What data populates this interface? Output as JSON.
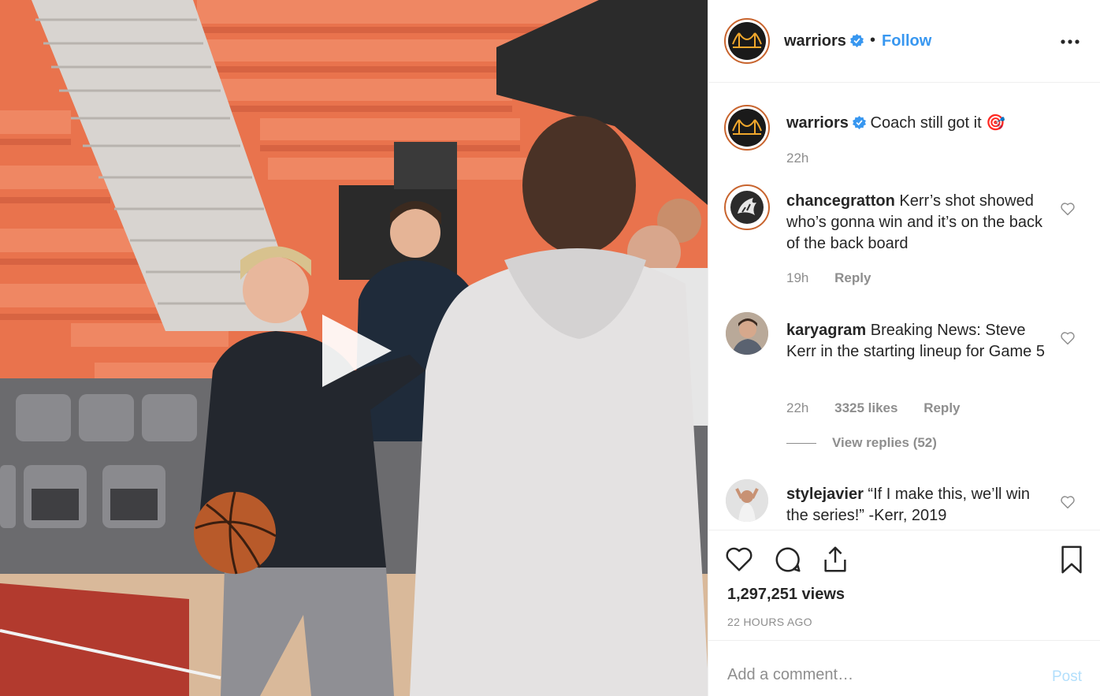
{
  "post": {
    "username": "warriors",
    "follow_label": "Follow",
    "separator": "•",
    "caption": "Coach still got it",
    "caption_emoji": "🎯",
    "caption_time": "22h"
  },
  "comments": [
    {
      "user": "chancegratton",
      "text": "Kerr’s shot showed who’s gonna win and it’s on the back of the back board",
      "time": "19h",
      "reply_label": "Reply"
    },
    {
      "user": "karyagram",
      "text": "Breaking News: Steve Kerr in the starting lineup for Game 5",
      "time": "22h",
      "likes": "3325 likes",
      "reply_label": "Reply",
      "view_replies": "View replies (52)"
    },
    {
      "user": "stylejavier",
      "text": "“If I make this, we’ll win the series!” -Kerr, 2019"
    }
  ],
  "stats": {
    "views": "1,297,251 views",
    "posted": "22 HOURS AGO"
  },
  "composer": {
    "placeholder": "Add a comment…",
    "post_label": "Post"
  },
  "icons": {
    "more": "more-options-icon",
    "like": "heart-icon",
    "comment": "comment-icon",
    "share": "share-icon",
    "save": "bookmark-icon",
    "play": "play-icon",
    "verified": "verified-badge-icon"
  },
  "colors": {
    "link": "#3897f0",
    "muted": "#8e8e8e",
    "text": "#262626",
    "post_disabled": "#b2dffc",
    "story_ring": "#c8642e"
  }
}
